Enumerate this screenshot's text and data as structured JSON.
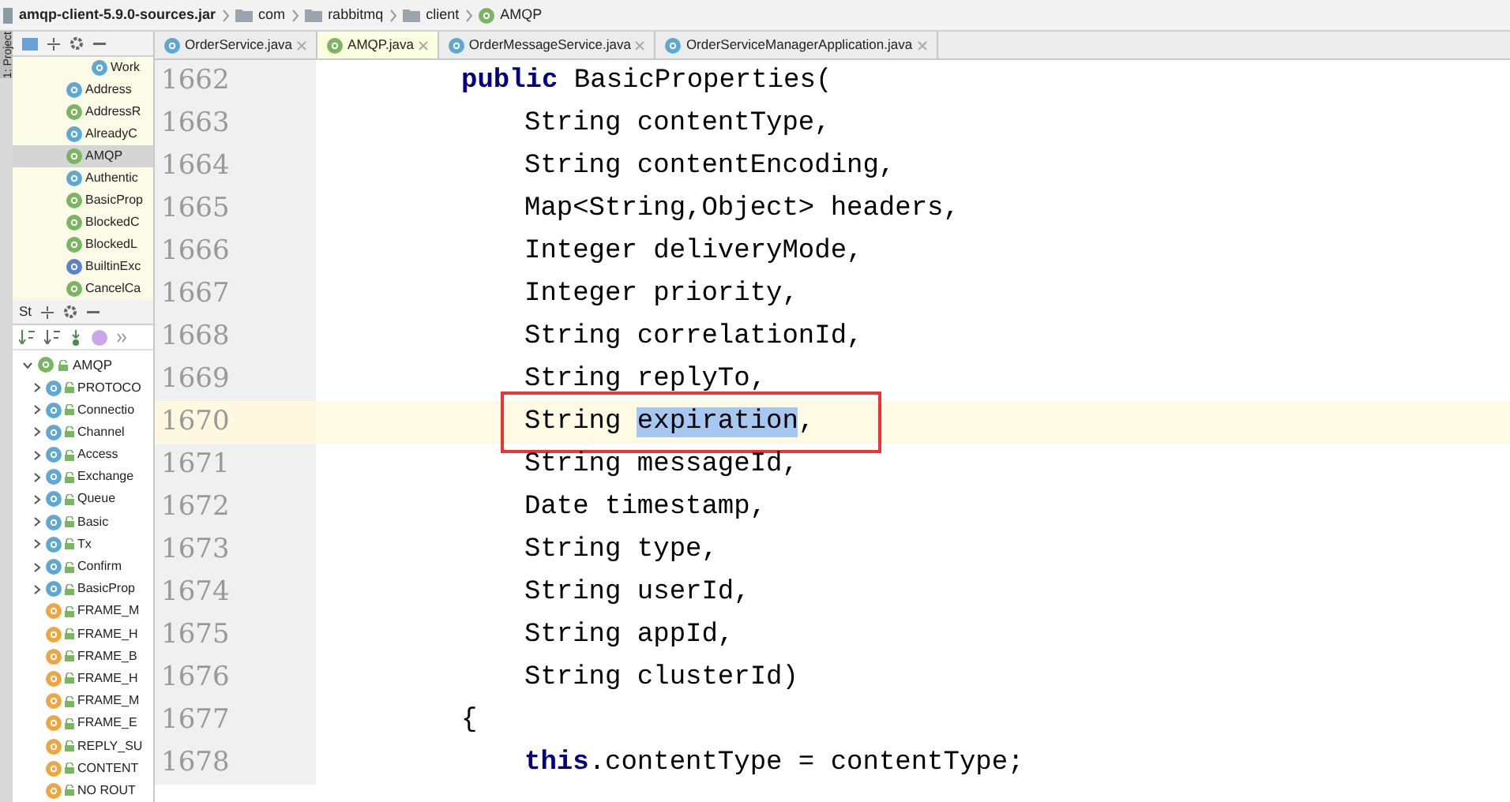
{
  "breadcrumb": [
    {
      "label": "amqp-client-5.9.0-sources.jar",
      "kind": "jar"
    },
    {
      "label": "com",
      "kind": "folder"
    },
    {
      "label": "rabbitmq",
      "kind": "folder"
    },
    {
      "label": "client",
      "kind": "folder"
    },
    {
      "label": "AMQP",
      "kind": "interface"
    }
  ],
  "side_strip": {
    "label": "1: Project"
  },
  "project_panel": {
    "items": [
      {
        "label": "Work",
        "kind": "class",
        "selected": false,
        "nested": true
      },
      {
        "label": "Address",
        "kind": "class",
        "selected": false,
        "nested": false
      },
      {
        "label": "AddressR",
        "kind": "interface",
        "selected": false,
        "nested": false
      },
      {
        "label": "AlreadyC",
        "kind": "class",
        "selected": false,
        "nested": false
      },
      {
        "label": "AMQP",
        "kind": "interface",
        "selected": true,
        "nested": false
      },
      {
        "label": "Authentic",
        "kind": "class",
        "selected": false,
        "nested": false
      },
      {
        "label": "BasicProp",
        "kind": "interface",
        "selected": false,
        "nested": false
      },
      {
        "label": "BlockedC",
        "kind": "interface",
        "selected": false,
        "nested": false
      },
      {
        "label": "BlockedL",
        "kind": "interface",
        "selected": false,
        "nested": false
      },
      {
        "label": "BuiltinExc",
        "kind": "enum",
        "selected": false,
        "nested": false
      },
      {
        "label": "CancelCa",
        "kind": "interface",
        "selected": false,
        "nested": false
      }
    ]
  },
  "structure_panel": {
    "title": "St",
    "root": {
      "label": "AMQP",
      "kind": "interface",
      "expanded": true,
      "children": [
        {
          "label": "PROTOCO",
          "kind": "class",
          "expanded": false
        },
        {
          "label": "Connectio",
          "kind": "class",
          "expanded": false
        },
        {
          "label": "Channel",
          "kind": "class",
          "expanded": false
        },
        {
          "label": "Access",
          "kind": "class",
          "expanded": false
        },
        {
          "label": "Exchange",
          "kind": "class",
          "expanded": false
        },
        {
          "label": "Queue",
          "kind": "class",
          "expanded": false
        },
        {
          "label": "Basic",
          "kind": "class",
          "expanded": false
        },
        {
          "label": "Tx",
          "kind": "class",
          "expanded": false
        },
        {
          "label": "Confirm",
          "kind": "class",
          "expanded": false
        },
        {
          "label": "BasicProp",
          "kind": "class",
          "expanded": false
        },
        {
          "label": "FRAME_M",
          "kind": "field"
        },
        {
          "label": "FRAME_H",
          "kind": "field"
        },
        {
          "label": "FRAME_B",
          "kind": "field"
        },
        {
          "label": "FRAME_H",
          "kind": "field"
        },
        {
          "label": "FRAME_M",
          "kind": "field"
        },
        {
          "label": "FRAME_E",
          "kind": "field"
        },
        {
          "label": "REPLY_SU",
          "kind": "field"
        },
        {
          "label": "CONTENT",
          "kind": "field"
        },
        {
          "label": "NO ROUT",
          "kind": "field"
        }
      ]
    }
  },
  "tabs": [
    {
      "label": "OrderService.java",
      "kind": "class",
      "selected": false
    },
    {
      "label": "AMQP.java",
      "kind": "interface",
      "selected": true
    },
    {
      "label": "OrderMessageService.java",
      "kind": "class",
      "selected": false
    },
    {
      "label": "OrderServiceManagerApplication.java",
      "kind": "app",
      "selected": false
    }
  ],
  "editor": {
    "lines": [
      {
        "number": "1662",
        "current": false,
        "boxed": false,
        "kind": "declaration",
        "segments": [
          {
            "text": "public",
            "kind": "keyword"
          },
          {
            "text": " BasicProperties(",
            "kind": "plain"
          }
        ]
      },
      {
        "number": "1663",
        "current": false,
        "boxed": false,
        "kind": "parameter",
        "segments": [
          {
            "text": "String contentType,",
            "kind": "plain"
          }
        ]
      },
      {
        "number": "1664",
        "current": false,
        "boxed": false,
        "kind": "parameter",
        "segments": [
          {
            "text": "String contentEncoding,",
            "kind": "plain"
          }
        ]
      },
      {
        "number": "1665",
        "current": false,
        "boxed": false,
        "kind": "parameter",
        "segments": [
          {
            "text": "Map<String,Object> headers,",
            "kind": "plain"
          }
        ]
      },
      {
        "number": "1666",
        "current": false,
        "boxed": false,
        "kind": "parameter",
        "segments": [
          {
            "text": "Integer deliveryMode,",
            "kind": "plain"
          }
        ]
      },
      {
        "number": "1667",
        "current": false,
        "boxed": false,
        "kind": "parameter",
        "segments": [
          {
            "text": "Integer priority,",
            "kind": "plain"
          }
        ]
      },
      {
        "number": "1668",
        "current": false,
        "boxed": false,
        "kind": "parameter",
        "segments": [
          {
            "text": "String correlationId,",
            "kind": "plain"
          }
        ]
      },
      {
        "number": "1669",
        "current": false,
        "boxed": false,
        "kind": "parameter",
        "segments": [
          {
            "text": "String replyTo,",
            "kind": "plain"
          }
        ]
      },
      {
        "number": "1670",
        "current": true,
        "boxed": true,
        "kind": "parameter",
        "segments": [
          {
            "text": "String ",
            "kind": "plain"
          },
          {
            "text": "expiration",
            "kind": "selection"
          },
          {
            "text": ",",
            "kind": "plain"
          }
        ]
      },
      {
        "number": "1671",
        "current": false,
        "boxed": false,
        "kind": "parameter",
        "segments": [
          {
            "text": "String messageId,",
            "kind": "plain"
          }
        ]
      },
      {
        "number": "1672",
        "current": false,
        "boxed": false,
        "kind": "parameter",
        "segments": [
          {
            "text": "Date timestamp,",
            "kind": "plain"
          }
        ]
      },
      {
        "number": "1673",
        "current": false,
        "boxed": false,
        "kind": "parameter",
        "segments": [
          {
            "text": "String type,",
            "kind": "plain"
          }
        ]
      },
      {
        "number": "1674",
        "current": false,
        "boxed": false,
        "kind": "parameter",
        "segments": [
          {
            "text": "String userId,",
            "kind": "plain"
          }
        ]
      },
      {
        "number": "1675",
        "current": false,
        "boxed": false,
        "kind": "parameter",
        "segments": [
          {
            "text": "String appId,",
            "kind": "plain"
          }
        ]
      },
      {
        "number": "1676",
        "current": false,
        "boxed": false,
        "kind": "parameter",
        "segments": [
          {
            "text": "String clusterId)",
            "kind": "plain"
          }
        ]
      },
      {
        "number": "1677",
        "current": false,
        "boxed": false,
        "kind": "declaration",
        "segments": [
          {
            "text": "{",
            "kind": "plain"
          }
        ]
      },
      {
        "number": "1678",
        "current": false,
        "boxed": false,
        "kind": "body",
        "segments": [
          {
            "text": "this",
            "kind": "keyword"
          },
          {
            "text": ".contentType = contentType;",
            "kind": "plain"
          }
        ]
      }
    ]
  }
}
